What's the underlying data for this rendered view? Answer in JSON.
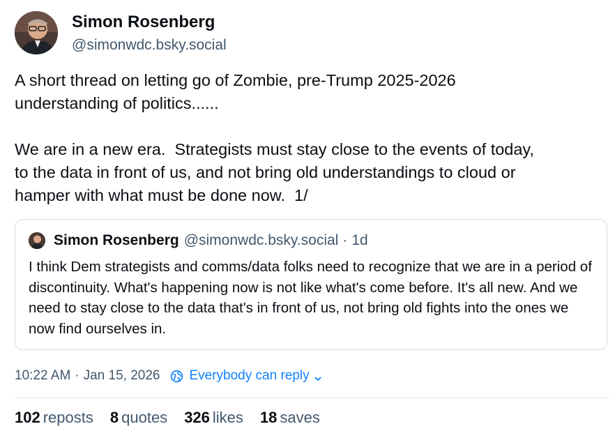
{
  "post": {
    "author": {
      "name": "Simon Rosenberg",
      "handle": "@simonwdc.bsky.social"
    },
    "text": "A short thread on letting go of Zombie, pre-Trump 2025-2026\nunderstanding of politics......\n\nWe are in a new era.  Strategists must stay close to the events of today,\nto the data in front of us, and not bring old understandings to cloud or\nhamper with what must be done now.  1/",
    "quote": {
      "name": "Simon Rosenberg",
      "handle": "@simonwdc.bsky.social",
      "separator": "·",
      "age": "1d",
      "text": "I think Dem strategists and comms/data folks need to recognize that we are in a period of discontinuity.  What's happening now is not like what's come before.  It's all new.  And we need to stay close to the data that's in front of us, not bring old fights into the ones we now find ourselves in."
    },
    "meta": {
      "time": "10:22 AM",
      "separator": "·",
      "date": "Jan 15, 2026",
      "reply_setting": "Everybody can reply",
      "reply_icon": "globe-icon",
      "accent_color": "#1083fe"
    },
    "stats": {
      "reposts": {
        "count": "102",
        "label": "reposts"
      },
      "quotes": {
        "count": "8",
        "label": "quotes"
      },
      "likes": {
        "count": "326",
        "label": "likes"
      },
      "saves": {
        "count": "18",
        "label": "saves"
      }
    }
  }
}
